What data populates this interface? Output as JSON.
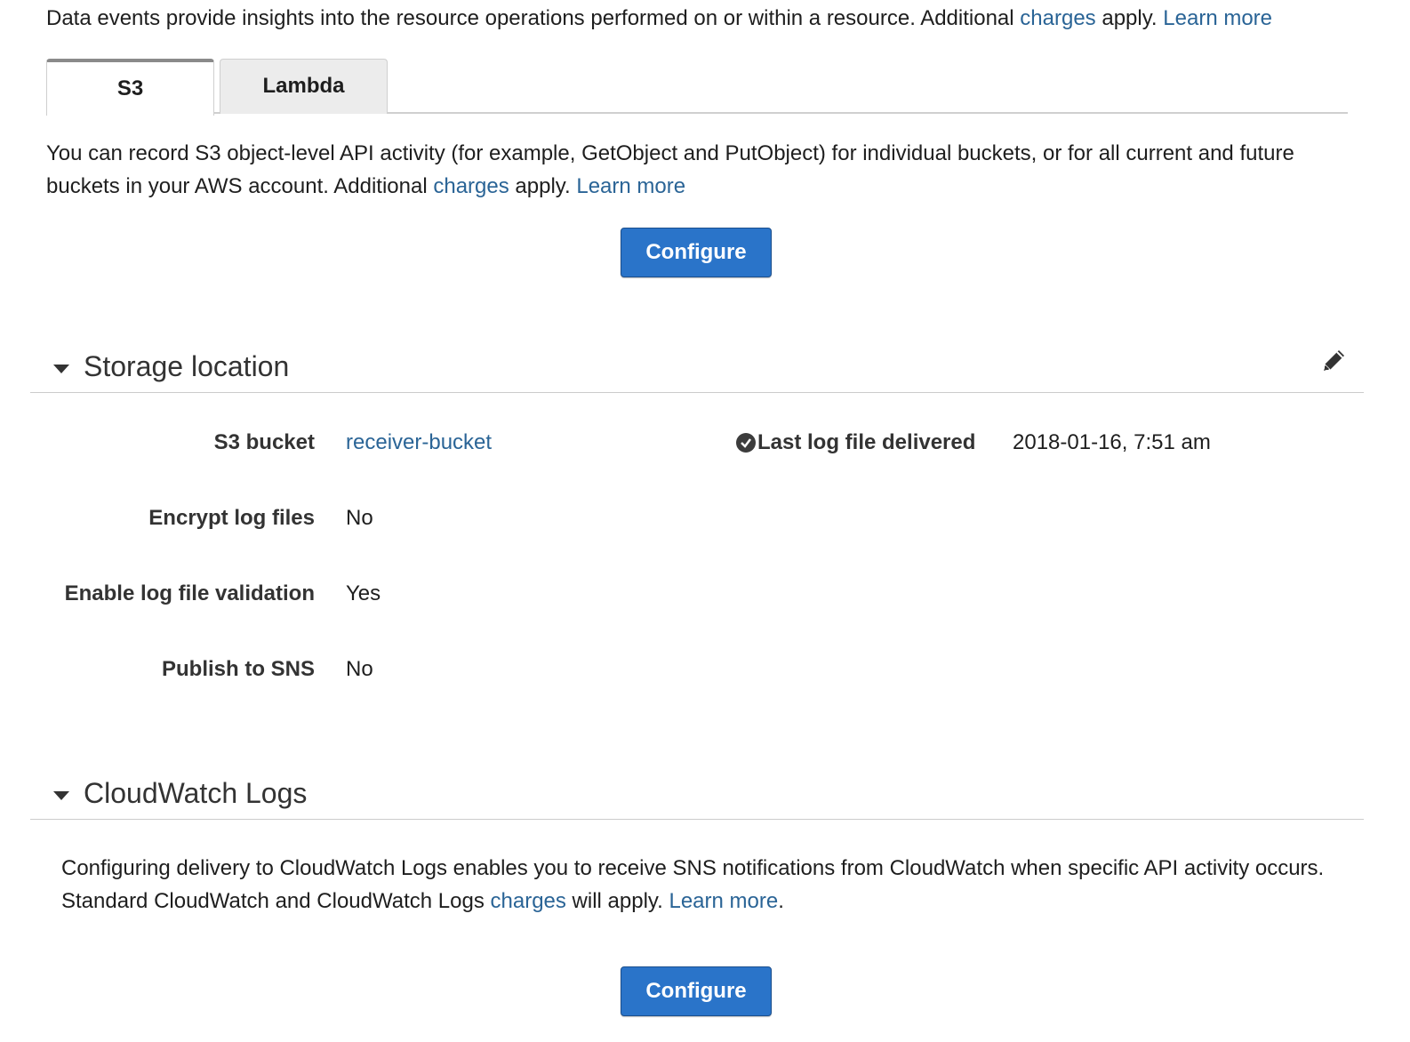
{
  "intro": {
    "text": "Data events provide insights into the resource operations performed on or within a resource. Additional ",
    "charges_link": "charges",
    "after": " apply. ",
    "learn_more": "Learn more"
  },
  "tabs": [
    {
      "label": "S3",
      "active": true
    },
    {
      "label": "Lambda",
      "active": false
    }
  ],
  "s3_panel": {
    "text": "You can record S3 object-level API activity (for example, GetObject and PutObject) for individual buckets, or for all current and future buckets in your AWS account. Additional ",
    "charges_link": "charges",
    "after": " apply. ",
    "learn_more": "Learn more",
    "configure_label": "Configure"
  },
  "storage_location": {
    "title": "Storage location",
    "edit_icon": "pencil-icon",
    "fields": [
      {
        "label": "S3 bucket",
        "value": "receiver-bucket",
        "is_link": true
      },
      {
        "label": "Encrypt log files",
        "value": "No"
      },
      {
        "label": "Enable log file validation",
        "value": "Yes"
      },
      {
        "label": "Publish to SNS",
        "value": "No"
      }
    ],
    "last_log": {
      "icon": "check-circle-icon",
      "label": "Last log file delivered",
      "value": "2018-01-16, 7:51 am"
    }
  },
  "cloudwatch": {
    "title": "CloudWatch Logs",
    "text": "Configuring delivery to CloudWatch Logs enables you to receive SNS notifications from CloudWatch when specific API activity occurs. Standard CloudWatch and CloudWatch Logs ",
    "charges_link": "charges",
    "after": " will apply. ",
    "learn_more": "Learn more",
    "end": ".",
    "configure_label": "Configure"
  },
  "colors": {
    "link": "#2a6496",
    "button": "#2a74c9",
    "divider": "#cccccc"
  }
}
